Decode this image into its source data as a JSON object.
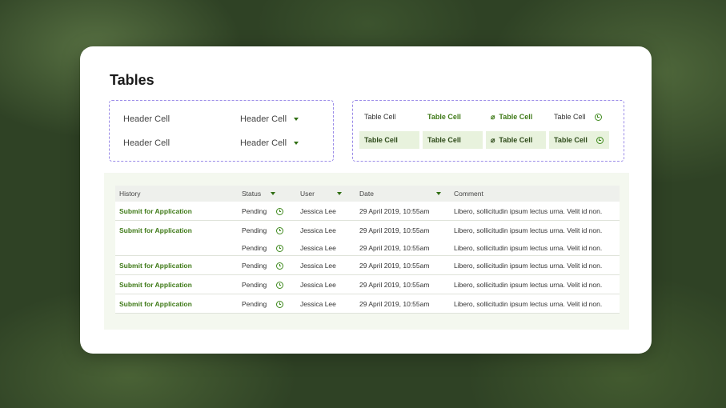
{
  "page": {
    "title": "Tables"
  },
  "header_cells": [
    {
      "left": "Header Cell",
      "right": "Header Cell"
    },
    {
      "left": "Header Cell",
      "right": "Header Cell"
    }
  ],
  "table_cells": {
    "row1": [
      "Table Cell",
      "Table Cell",
      "Table Cell",
      "Table Cell"
    ],
    "row2": [
      "Table Cell",
      "Table Cell",
      "Table Cell",
      "Table Cell"
    ]
  },
  "table": {
    "columns": [
      "History",
      "Status",
      "User",
      "Date",
      "Comment"
    ],
    "rows": [
      {
        "history": "Submit for Application",
        "status": "Pending",
        "user": "Jessica Lee",
        "date": "29 April 2019, 10:55am",
        "comment": "Libero, sollicitudin ipsum lectus urna. Velit id non."
      },
      {
        "history": "Submit for Application",
        "status": "Pending",
        "user": "Jessica Lee",
        "date": "29 April 2019, 10:55am",
        "comment": "Libero, sollicitudin ipsum lectus urna. Velit id non."
      },
      {
        "history": "",
        "status": "Pending",
        "user": "Jessica Lee",
        "date": "29 April 2019, 10:55am",
        "comment": "Libero, sollicitudin ipsum lectus urna. Velit id non."
      },
      {
        "history": "Submit for Application",
        "status": "Pending",
        "user": "Jessica Lee",
        "date": "29 April 2019, 10:55am",
        "comment": "Libero, sollicitudin ipsum lectus urna. Velit id non."
      },
      {
        "history": "Submit for Application",
        "status": "Pending",
        "user": "Jessica Lee",
        "date": "29 April 2019, 10:55am",
        "comment": "Libero, sollicitudin ipsum lectus urna. Velit id non."
      },
      {
        "history": "Submit for Application",
        "status": "Pending",
        "user": "Jessica Lee",
        "date": "29 April 2019, 10:55am",
        "comment": "Libero, sollicitudin ipsum lectus urna. Velit id non."
      }
    ]
  },
  "colors": {
    "accent": "#3f7a18",
    "dashed_border": "#9b8ce8",
    "highlight_bg": "#e8f2dd"
  },
  "icons": [
    "caret-down-icon",
    "clock-icon",
    "paperclip-icon"
  ]
}
